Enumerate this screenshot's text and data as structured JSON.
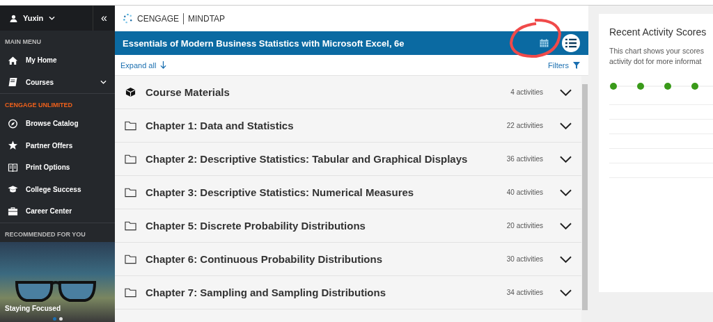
{
  "sidebar": {
    "user": "Yuxin",
    "collapse_icon": "«",
    "sections": [
      {
        "heading": "MAIN MENU",
        "kind": "plain",
        "items": [
          {
            "label": "My Home",
            "kind": "link"
          },
          {
            "label": "Courses",
            "kind": "dropdown"
          }
        ]
      },
      {
        "heading": "CENGAGE UNLIMITED",
        "kind": "accent",
        "items": [
          {
            "label": "Browse Catalog",
            "kind": "link"
          },
          {
            "label": "Partner Offers",
            "kind": "link"
          },
          {
            "label": "Print Options",
            "kind": "link"
          },
          {
            "label": "College Success",
            "kind": "link"
          },
          {
            "label": "Career Center",
            "kind": "link"
          }
        ]
      }
    ],
    "recommended": {
      "heading": "RECOMMENDED FOR YOU",
      "caption": "Staying Focused",
      "slides": [
        {
          "selected": true
        },
        {
          "selected": false
        }
      ]
    }
  },
  "brand": {
    "name": "CENGAGE",
    "product": "MINDTAP"
  },
  "course": {
    "title": "Essentials of Modern Business Statistics with Microsoft Excel, 6e",
    "expand_all": "Expand all",
    "filters": "Filters",
    "units": [
      {
        "kind": "materials",
        "title": "Course Materials",
        "count": "4 activities",
        "expanded": false
      },
      {
        "kind": "folder",
        "title": "Chapter 1: Data and Statistics",
        "count": "22 activities",
        "expanded": false
      },
      {
        "kind": "folder",
        "title": "Chapter 2: Descriptive Statistics: Tabular and Graphical Displays",
        "count": "36 activities",
        "expanded": false
      },
      {
        "kind": "folder",
        "title": "Chapter 3: Descriptive Statistics: Numerical Measures",
        "count": "40 activities",
        "expanded": false
      },
      {
        "kind": "folder",
        "title": "Chapter 5: Discrete Probability Distributions",
        "count": "20 activities",
        "expanded": false
      },
      {
        "kind": "folder",
        "title": "Chapter 6: Continuous Probability Distributions",
        "count": "30 activities",
        "expanded": false
      },
      {
        "kind": "folder",
        "title": "Chapter 7: Sampling and Sampling Distributions",
        "count": "34 activities",
        "expanded": false
      }
    ]
  },
  "recent_scores": {
    "title": "Recent Activity Scores",
    "description_lines": [
      "This chart shows your scores",
      "activity dot for more informat"
    ]
  }
}
